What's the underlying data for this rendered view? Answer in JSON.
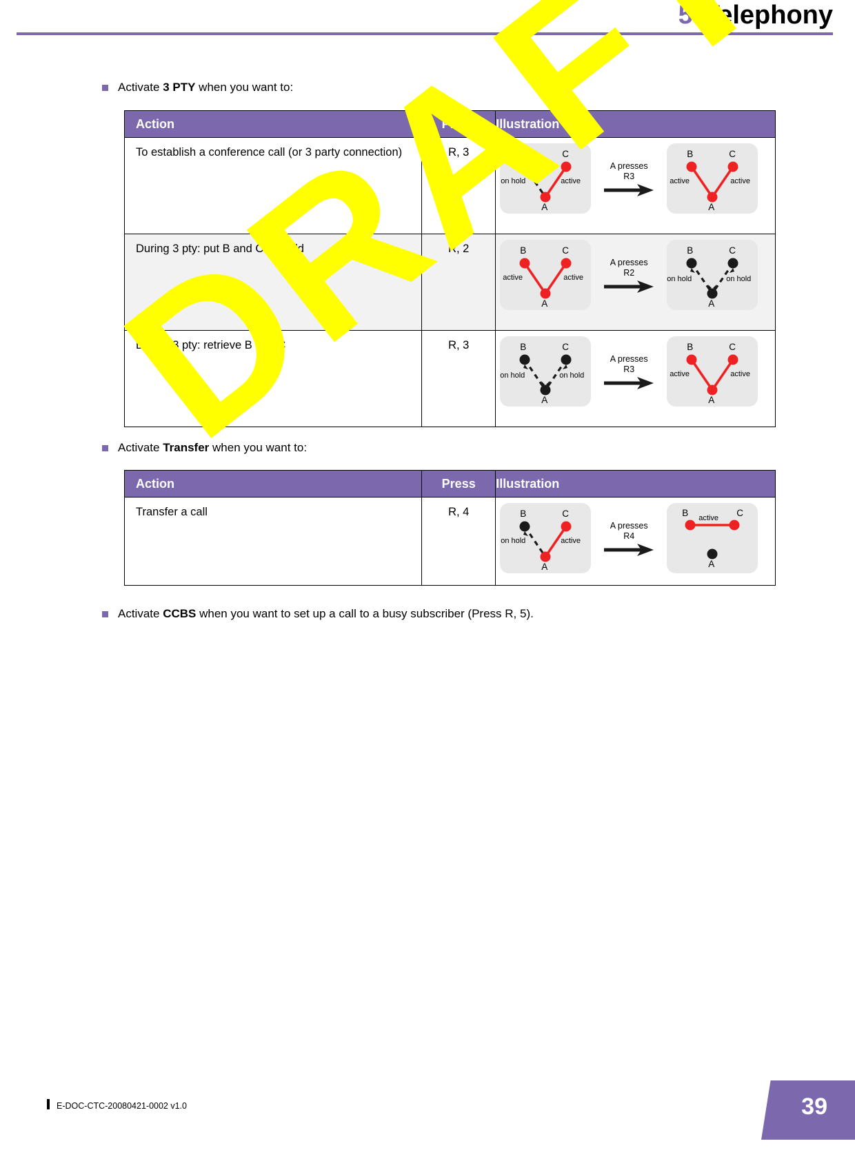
{
  "header": {
    "chapter_number": "5",
    "chapter_title": "Telephony"
  },
  "watermark": {
    "text": "DRAFT"
  },
  "bullets": {
    "three_pty": {
      "prefix": "Activate ",
      "bold": "3 PTY",
      "suffix": " when you want to:"
    },
    "transfer": {
      "prefix": "Activate ",
      "bold": "Transfer",
      "suffix": " when you want to:"
    },
    "ccbs": {
      "prefix": "Activate ",
      "bold": "CCBS",
      "suffix": " when you want to set up a call to a busy subscriber (Press R, 5)."
    }
  },
  "table_3pty": {
    "columns": {
      "action": "Action",
      "press": "Press",
      "illustration": "Illustration"
    },
    "rows": [
      {
        "action": "To establish a conference call (or 3 party connection)",
        "press": "R, 3",
        "illustration": {
          "before": {
            "b_label": "B",
            "c_label": "C",
            "a_label": "A",
            "b_state": "on hold",
            "c_state": "active",
            "b_active": false,
            "c_active": true,
            "a_active": true,
            "link_ab": "dashed",
            "link_ac": "solid"
          },
          "transition": {
            "line1": "A presses",
            "line2": "R3"
          },
          "after": {
            "b_label": "B",
            "c_label": "C",
            "a_label": "A",
            "b_state": "active",
            "c_state": "active",
            "b_active": true,
            "c_active": true,
            "a_active": true,
            "link_ab": "solid",
            "link_ac": "solid"
          }
        }
      },
      {
        "action": "During 3 pty: put B and C on hold",
        "press": "R, 2",
        "illustration": {
          "before": {
            "b_label": "B",
            "c_label": "C",
            "a_label": "A",
            "b_state": "active",
            "c_state": "active",
            "b_active": true,
            "c_active": true,
            "a_active": true,
            "link_ab": "solid",
            "link_ac": "solid"
          },
          "transition": {
            "line1": "A presses",
            "line2": "R2"
          },
          "after": {
            "b_label": "B",
            "c_label": "C",
            "a_label": "A",
            "b_state": "on hold",
            "c_state": "on hold",
            "b_active": false,
            "c_active": false,
            "a_active": false,
            "link_ab": "dashed",
            "link_ac": "dashed"
          }
        }
      },
      {
        "action": "During 3 pty: retrieve B and C",
        "press": "R, 3",
        "illustration": {
          "before": {
            "b_label": "B",
            "c_label": "C",
            "a_label": "A",
            "b_state": "on hold",
            "c_state": "on hold",
            "b_active": false,
            "c_active": false,
            "a_active": false,
            "link_ab": "dashed",
            "link_ac": "dashed"
          },
          "transition": {
            "line1": "A presses",
            "line2": "R3"
          },
          "after": {
            "b_label": "B",
            "c_label": "C",
            "a_label": "A",
            "b_state": "active",
            "c_state": "active",
            "b_active": true,
            "c_active": true,
            "a_active": true,
            "link_ab": "solid",
            "link_ac": "solid"
          }
        }
      }
    ]
  },
  "table_transfer": {
    "columns": {
      "action": "Action",
      "press": "Press",
      "illustration": "Illustration"
    },
    "rows": [
      {
        "action": "Transfer a call",
        "press": "R, 4",
        "illustration": {
          "before": {
            "b_label": "B",
            "c_label": "C",
            "a_label": "A",
            "b_state": "on hold",
            "c_state": "active",
            "b_active": false,
            "c_active": true,
            "a_active": true,
            "link_ab": "dashed",
            "link_ac": "solid"
          },
          "transition": {
            "line1": "A presses",
            "line2": "R4"
          },
          "after_bc": {
            "b_label": "B",
            "c_label": "C",
            "a_label": "A",
            "bc_state": "active",
            "a_active": false
          }
        }
      }
    ]
  },
  "footer": {
    "doc_id": "E-DOC-CTC-20080421-0002 v1.0",
    "page_number": "39"
  },
  "colors": {
    "accent": "#7b68ad",
    "active_node": "#ee2222",
    "hold_node": "#1a1a1a",
    "scene_bg": "#e8e8e8",
    "watermark": "#ffff00"
  }
}
